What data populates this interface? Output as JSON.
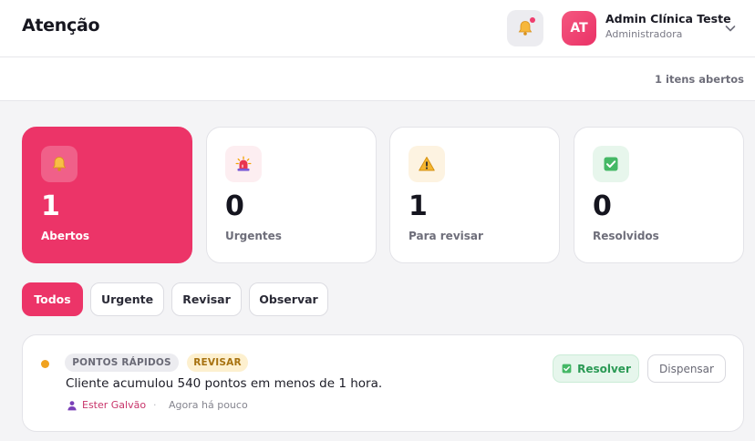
{
  "header": {
    "title": "Atenção",
    "user": {
      "initials": "AT",
      "name": "Admin Clínica Teste",
      "role": "Administradora"
    }
  },
  "subbar": {
    "open_count_text": "1 itens abertos"
  },
  "stats": [
    {
      "value": "1",
      "label": "Abertos",
      "icon": "bell-icon",
      "active": true
    },
    {
      "value": "0",
      "label": "Urgentes",
      "icon": "siren-icon",
      "active": false
    },
    {
      "value": "1",
      "label": "Para revisar",
      "icon": "warning-icon",
      "active": false
    },
    {
      "value": "0",
      "label": "Resolvidos",
      "icon": "check-box-icon",
      "active": false
    }
  ],
  "filters": [
    {
      "label": "Todos",
      "active": true
    },
    {
      "label": "Urgente",
      "active": false
    },
    {
      "label": "Revisar",
      "active": false
    },
    {
      "label": "Observar",
      "active": false
    }
  ],
  "items": [
    {
      "category": "PONTOS RÁPIDOS",
      "status": "REVISAR",
      "text": "Cliente acumulou 540 pontos em menos de 1 hora.",
      "author": "Ester Galvão",
      "separator": "·",
      "time": "Agora há pouco",
      "resolve_label": "Resolver",
      "dismiss_label": "Dispensar"
    }
  ],
  "colors": {
    "accent": "#ec3468",
    "warning_dot": "#f0a21f",
    "success": "#2b9a55"
  }
}
